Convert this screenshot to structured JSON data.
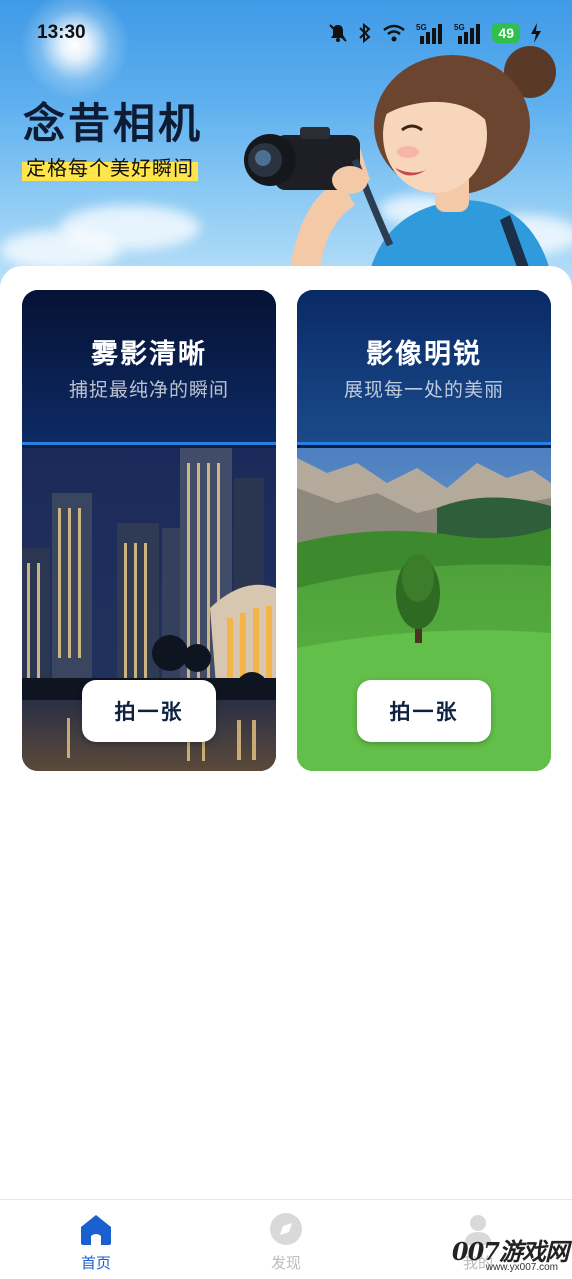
{
  "status_bar": {
    "time": "13:30",
    "battery": "49",
    "signal_label_1": "5G",
    "signal_label_2": "5G",
    "icons": [
      "mute-bell-icon",
      "bluetooth-icon",
      "wifi-icon",
      "signal-5g-icon",
      "signal-5g-icon",
      "battery-icon",
      "charging-icon"
    ]
  },
  "hero": {
    "app_title": "念昔相机",
    "tagline": "定格每个美好瞬间"
  },
  "cards": [
    {
      "title": "雾影清晰",
      "subtitle": "捕捉最纯净的瞬间",
      "button": "拍一张",
      "image": "night-city-skyline"
    },
    {
      "title": "影像明锐",
      "subtitle": "展现每一处的美丽",
      "button": "拍一张",
      "image": "mountain-meadow-tree"
    }
  ],
  "bottom_nav": {
    "items": [
      {
        "label": "首页",
        "icon": "home-icon",
        "active": true
      },
      {
        "label": "发现",
        "icon": "compass-icon",
        "active": false
      },
      {
        "label": "我的",
        "icon": "person-icon",
        "active": false
      }
    ]
  },
  "watermark": {
    "text": "007游戏网",
    "url": "www.yx007.com"
  },
  "colors": {
    "accent": "#1a5fd0",
    "card_header": "#061235",
    "highlight": "#ffe54a"
  }
}
